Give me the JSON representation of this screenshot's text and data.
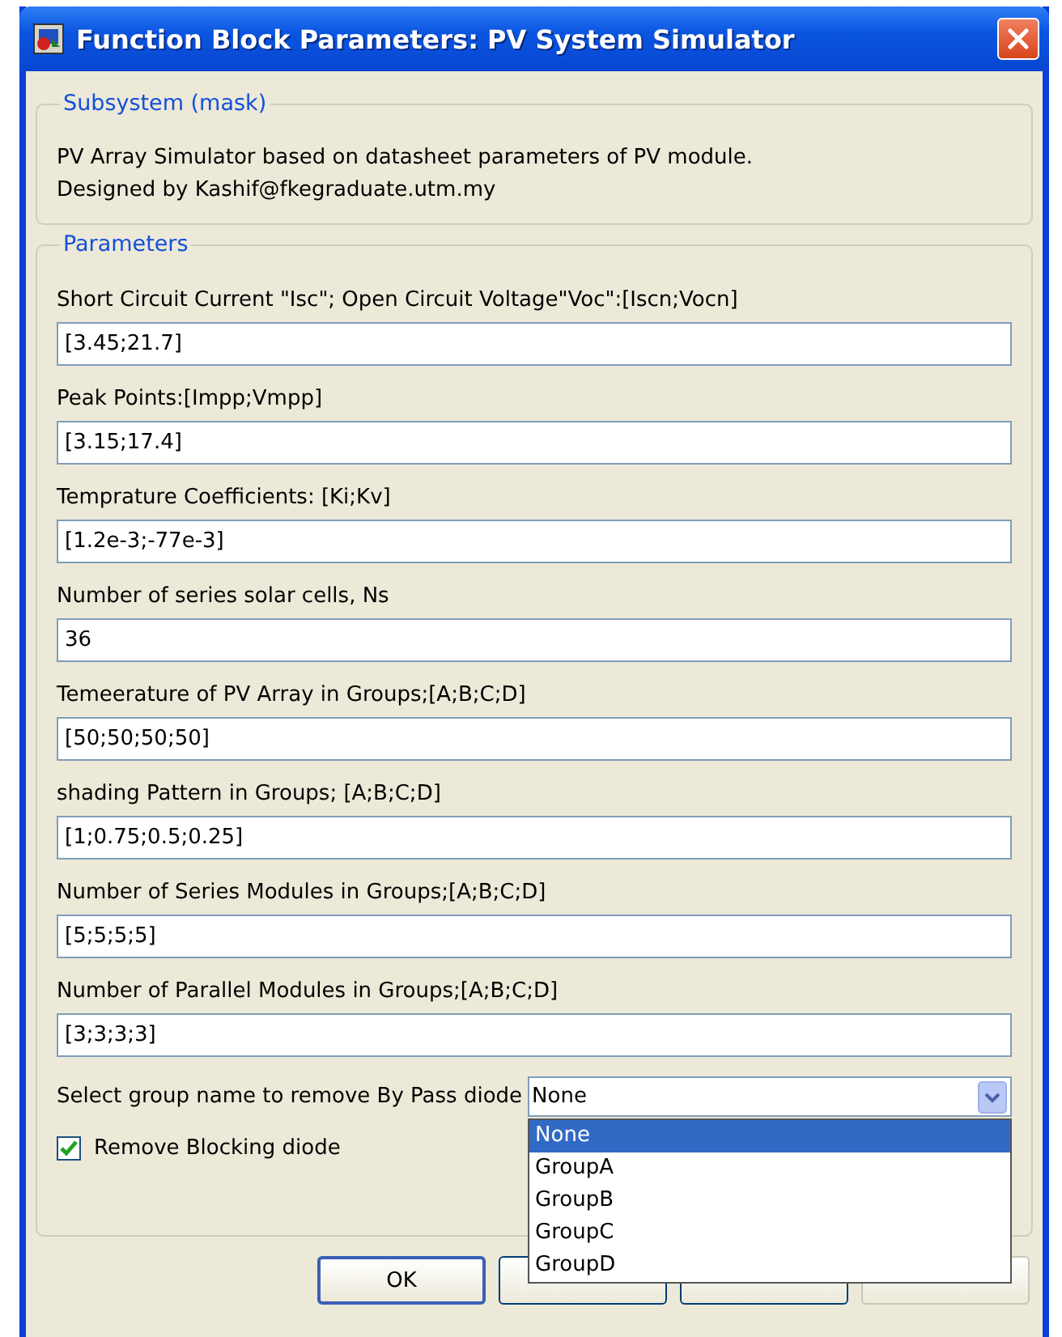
{
  "window": {
    "title": "Function Block Parameters: PV System Simulator"
  },
  "description_group": {
    "title": "Subsystem (mask)",
    "lines": [
      "PV Array Simulator based on datasheet parameters of PV module.",
      "Designed by Kashif@fkegraduate.utm.my"
    ]
  },
  "parameters_group": {
    "title": "Parameters",
    "fields": [
      {
        "label": "Short Circuit Current \"Isc\"; Open Circuit Voltage\"Voc\":[Iscn;Vocn]",
        "value": "[3.45;21.7]"
      },
      {
        "label": "Peak Points:[Impp;Vmpp]",
        "value": "[3.15;17.4]"
      },
      {
        "label": "Temprature Coefficients: [Ki;Kv]",
        "value": "[1.2e-3;-77e-3]"
      },
      {
        "label": "Number of series solar cells, Ns",
        "value": "36"
      },
      {
        "label": "Temeerature of PV Array in Groups;[A;B;C;D]",
        "value": "[50;50;50;50]"
      },
      {
        "label": "shading Pattern in Groups; [A;B;C;D]",
        "value": "[1;0.75;0.5;0.25]"
      },
      {
        "label": "Number of Series Modules in Groups;[A;B;C;D]",
        "value": "[5;5;5;5]"
      },
      {
        "label": "Number of Parallel Modules in Groups;[A;B;C;D]",
        "value": "[3;3;3;3]"
      }
    ],
    "bypass_select": {
      "label": "Select group name to remove By Pass diode",
      "value": "None",
      "expanded": true,
      "options": [
        {
          "label": "None",
          "selected": true
        },
        {
          "label": "GroupA",
          "selected": false
        },
        {
          "label": "GroupB",
          "selected": false
        },
        {
          "label": "GroupC",
          "selected": false
        },
        {
          "label": "GroupD",
          "selected": false
        }
      ]
    },
    "blocking_checkbox": {
      "label": "Remove Blocking diode",
      "checked": true
    }
  },
  "buttons": [
    {
      "label": "OK",
      "disabled": false
    },
    {
      "disabled": false
    },
    {
      "disabled": false
    },
    {
      "disabled": true
    }
  ]
}
